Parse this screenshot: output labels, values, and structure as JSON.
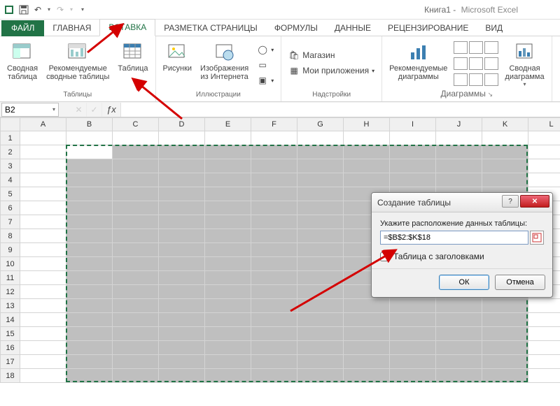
{
  "titlebar": {
    "workbook": "Книга1",
    "appName": "Microsoft Excel"
  },
  "tabs": {
    "file": "ФАЙЛ",
    "home": "ГЛАВНАЯ",
    "insert": "ВСТАВКА",
    "layout": "РАЗМЕТКА СТРАНИЦЫ",
    "formulas": "ФОРМУЛЫ",
    "data": "ДАННЫЕ",
    "review": "РЕЦЕНЗИРОВАНИЕ",
    "view": "ВИД"
  },
  "ribbon": {
    "groups": {
      "tables": {
        "label": "Таблицы",
        "pivot": "Сводная\nтаблица",
        "recommendedPivot": "Рекомендуемые\nсводные таблицы",
        "table": "Таблица"
      },
      "illustrations": {
        "label": "Иллюстрации",
        "pictures": "Рисунки",
        "onlinePictures": "Изображения\nиз Интернета"
      },
      "addins": {
        "label": "Надстройки",
        "store": "Магазин",
        "myapps": "Мои приложения"
      },
      "charts": {
        "label": "Диаграммы",
        "recommended": "Рекомендуемые\nдиаграммы",
        "pivotChart": "Сводная\nдиаграмма"
      }
    }
  },
  "namebox": {
    "value": "B2"
  },
  "grid": {
    "columns": [
      "A",
      "B",
      "C",
      "D",
      "E",
      "F",
      "G",
      "H",
      "I",
      "J",
      "K",
      "L"
    ],
    "rows": [
      1,
      2,
      3,
      4,
      5,
      6,
      7,
      8,
      9,
      10,
      11,
      12,
      13,
      14,
      15,
      16,
      17,
      18
    ]
  },
  "dialog": {
    "title": "Создание таблицы",
    "hint": "Укажите расположение данных таблицы:",
    "range": "=$B$2:$K$18",
    "withHeaders": "Таблица с заголовками",
    "ok": "ОК",
    "cancel": "Отмена"
  }
}
